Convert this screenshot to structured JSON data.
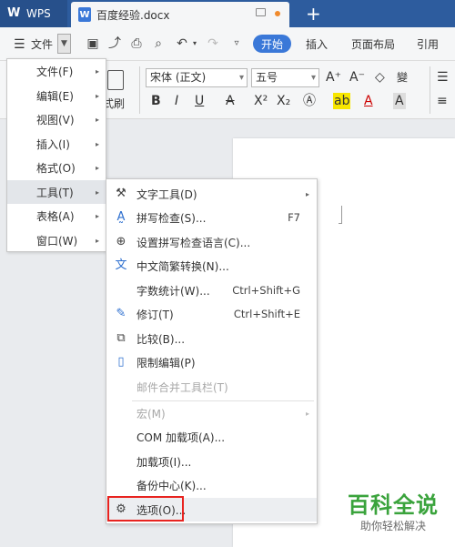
{
  "titlebar": {
    "app_label": "WPS",
    "doc_tab": "百度经验.docx",
    "new_tab": "+"
  },
  "toolbar": {
    "menu_label": "文件",
    "start": "开始",
    "tabs": [
      "插入",
      "页面布局",
      "引用"
    ]
  },
  "ribbon": {
    "font_name": "宋体 (正文)",
    "font_size": "五号",
    "brush_label": "式刷"
  },
  "left_menu": {
    "items": [
      {
        "label": "文件(F)"
      },
      {
        "label": "编辑(E)"
      },
      {
        "label": "视图(V)"
      },
      {
        "label": "插入(I)"
      },
      {
        "label": "格式(O)"
      },
      {
        "label": "工具(T)"
      },
      {
        "label": "表格(A)"
      },
      {
        "label": "窗口(W)"
      }
    ]
  },
  "sub_menu": {
    "items": [
      {
        "label": "文字工具(D)",
        "shortcut": "",
        "icon": "text-tool-icon"
      },
      {
        "label": "拼写检查(S)...",
        "shortcut": "F7",
        "icon": "spell-check-icon"
      },
      {
        "label": "设置拼写检查语言(C)...",
        "shortcut": "",
        "icon": "globe-icon"
      },
      {
        "label": "中文简繁转换(N)...",
        "shortcut": "",
        "icon": "convert-icon"
      },
      {
        "label": "字数统计(W)...",
        "shortcut": "Ctrl+Shift+G",
        "icon": ""
      },
      {
        "label": "修订(T)",
        "shortcut": "Ctrl+Shift+E",
        "icon": "revision-icon"
      },
      {
        "label": "比较(B)...",
        "shortcut": "",
        "icon": "compare-icon"
      },
      {
        "label": "限制编辑(P)",
        "shortcut": "",
        "icon": "restrict-icon"
      },
      {
        "label": "邮件合并工具栏(T)",
        "shortcut": "",
        "icon": ""
      },
      {
        "label": "宏(M)",
        "shortcut": "",
        "icon": ""
      },
      {
        "label": "COM 加载项(A)...",
        "shortcut": "",
        "icon": ""
      },
      {
        "label": "加载项(I)...",
        "shortcut": "",
        "icon": ""
      },
      {
        "label": "备份中心(K)...",
        "shortcut": "",
        "icon": ""
      },
      {
        "label": "选项(O)...",
        "shortcut": "",
        "icon": "gear-icon"
      }
    ]
  },
  "watermark": {
    "title": "百科全说",
    "subtitle": "助你轻松解决"
  },
  "colors": {
    "accent": "#3a78d8",
    "title_bar": "#2d5c9e",
    "highlight_box": "#e8231f",
    "watermark": "#3aa33c"
  }
}
